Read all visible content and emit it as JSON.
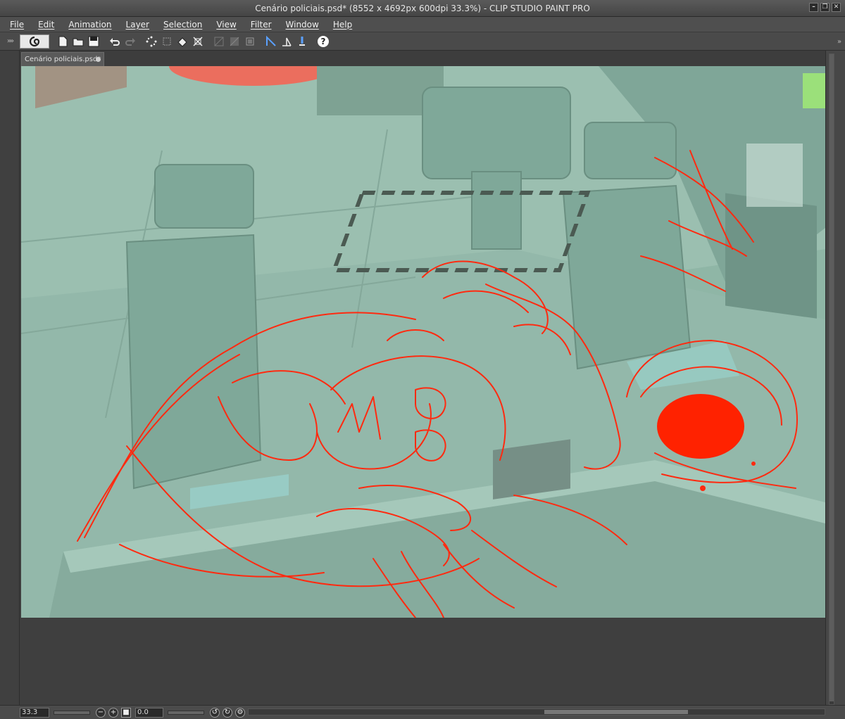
{
  "window": {
    "title": "Cenário policiais.psd* (8552 x 4692px 600dpi 33.3%)  - CLIP STUDIO PAINT PRO",
    "controls": [
      "minimize",
      "restore",
      "close"
    ]
  },
  "menu": {
    "items": [
      "File",
      "Edit",
      "Animation",
      "Layer",
      "Selection",
      "View",
      "Filter",
      "Window",
      "Help"
    ]
  },
  "toolbar": {
    "icons": [
      "clip-studio-logo-icon",
      "new-file-icon",
      "open-file-icon",
      "save-icon",
      "undo-icon",
      "redo-icon",
      "select-points-icon",
      "transform-icon",
      "fill-icon",
      "fit-selection-icon",
      "layer-icon",
      "layer-grid-icon",
      "frame-icon",
      "ruler-icon",
      "perspective-icon",
      "pen-icon",
      "help-icon"
    ]
  },
  "document": {
    "tab_label": "Cenário policiais.psd*"
  },
  "status": {
    "zoom": "33.3",
    "rotation": "0.0"
  },
  "colors": {
    "sketch_red": "#ff2a10",
    "canvas_bg_teal": "#8fb7a8",
    "ui_dark": "#3c3c3c"
  }
}
